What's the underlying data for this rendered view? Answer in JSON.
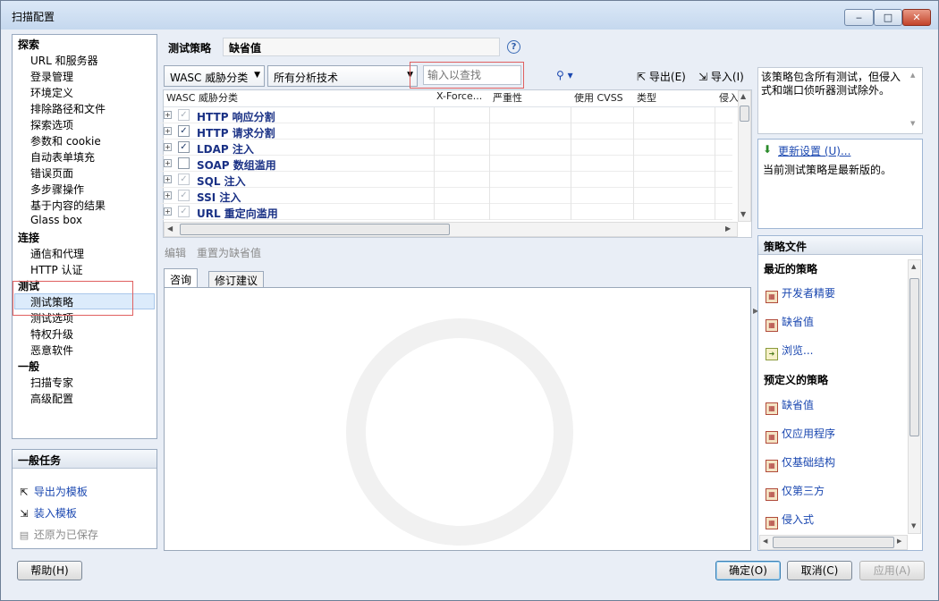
{
  "window": {
    "title": "扫描配置",
    "min": "‒",
    "max": "□",
    "close": "✕"
  },
  "nav": {
    "sections": [
      {
        "label": "探索",
        "items": [
          "URL 和服务器",
          "登录管理",
          "环境定义",
          "排除路径和文件",
          "探索选项",
          "参数和 cookie",
          "自动表单填充",
          "错误页面",
          "多步骤操作",
          "基于内容的结果",
          "Glass box"
        ]
      },
      {
        "label": "连接",
        "items": [
          "通信和代理",
          "HTTP 认证"
        ]
      },
      {
        "label": "测试",
        "items": [
          "测试策略",
          "测试选项",
          "特权升级",
          "恶意软件"
        ]
      },
      {
        "label": "一般",
        "items": [
          "扫描专家",
          "高级配置"
        ]
      }
    ],
    "selected": "测试策略"
  },
  "tasks": {
    "title": "一般任务",
    "items": [
      "导出为模板",
      "装入模板",
      "还原为已保存"
    ]
  },
  "help_button": "帮助(H)",
  "policy_header": {
    "label": "测试策略",
    "value": "缺省值",
    "help_icon": "?"
  },
  "toolbar": {
    "group_combo": "WASC 威胁分类",
    "tech_combo": "所有分析技术",
    "search_placeholder": "输入以查找",
    "export_label": "导出(E)",
    "import_label": "导入(I)"
  },
  "grid": {
    "columns": [
      "WASC 威胁分类",
      "X-Force...",
      "严重性",
      "使用 CVSS",
      "类型",
      "侵入"
    ],
    "rows": [
      {
        "label": "HTTP 响应分割",
        "checked": true,
        "disabled": true
      },
      {
        "label": "HTTP 请求分割",
        "checked": true,
        "disabled": false
      },
      {
        "label": "LDAP 注入",
        "checked": true,
        "disabled": false
      },
      {
        "label": "SOAP 数组滥用",
        "checked": false,
        "disabled": false
      },
      {
        "label": "SQL 注入",
        "checked": true,
        "disabled": true
      },
      {
        "label": "SSI 注入",
        "checked": true,
        "disabled": true
      },
      {
        "label": "URL 重定向滥用",
        "checked": true,
        "disabled": true
      }
    ]
  },
  "actions": {
    "edit": "编辑",
    "reset": "重置为缺省值"
  },
  "tabs": [
    "咨询",
    "修订建议"
  ],
  "description": "该策略包含所有测试，但侵入式和端口侦听器测试除外。",
  "update": {
    "link": "更新设置 (U)...",
    "status": "当前测试策略是最新版的。"
  },
  "policy_files": {
    "title": "策略文件",
    "recent_label": "最近的策略",
    "recent": [
      "开发者精要",
      "缺省值",
      "浏览..."
    ],
    "predefined_label": "预定义的策略",
    "predefined": [
      "缺省值",
      "仅应用程序",
      "仅基础结构",
      "仅第三方",
      "侵入式"
    ]
  },
  "footer": {
    "ok": "确定(O)",
    "cancel": "取消(C)",
    "apply": "应用(A)"
  }
}
